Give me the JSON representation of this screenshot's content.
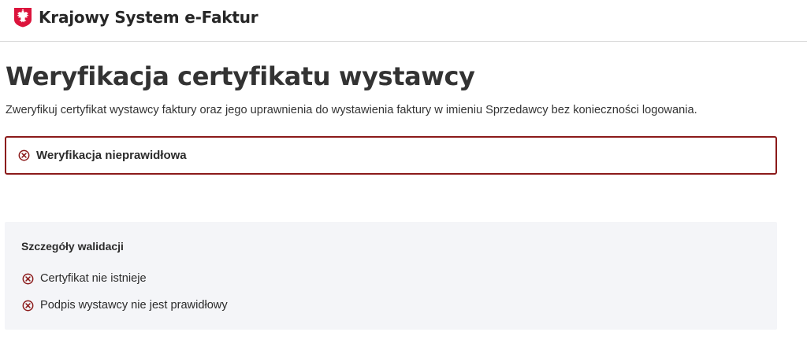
{
  "header": {
    "brand_name": "Krajowy System e-Faktur",
    "emblem_icon": "polish-eagle-emblem-icon",
    "emblem_color": "#dc143c"
  },
  "main": {
    "title": "Weryfikacja certyfikatu wystawcy",
    "description": "Zweryfikuj certyfikat wystawcy faktury oraz jego uprawnienia do wystawienia faktury w imieniu Sprzedawcy bez konieczności logowania."
  },
  "alert": {
    "icon": "error-circle-x-icon",
    "message": "Weryfikacja nieprawidłowa",
    "border_color": "#8b1a1a"
  },
  "validation": {
    "title": "Szczegóły walidacji",
    "items": [
      {
        "icon": "error-circle-x-icon",
        "label": "Certyfikat nie istnieje"
      },
      {
        "icon": "error-circle-x-icon",
        "label": "Podpis wystawcy nie jest prawidłowy"
      }
    ],
    "background": "#f4f5f8"
  },
  "colors": {
    "error": "#8b1a1a",
    "text": "#2b2b2b"
  }
}
